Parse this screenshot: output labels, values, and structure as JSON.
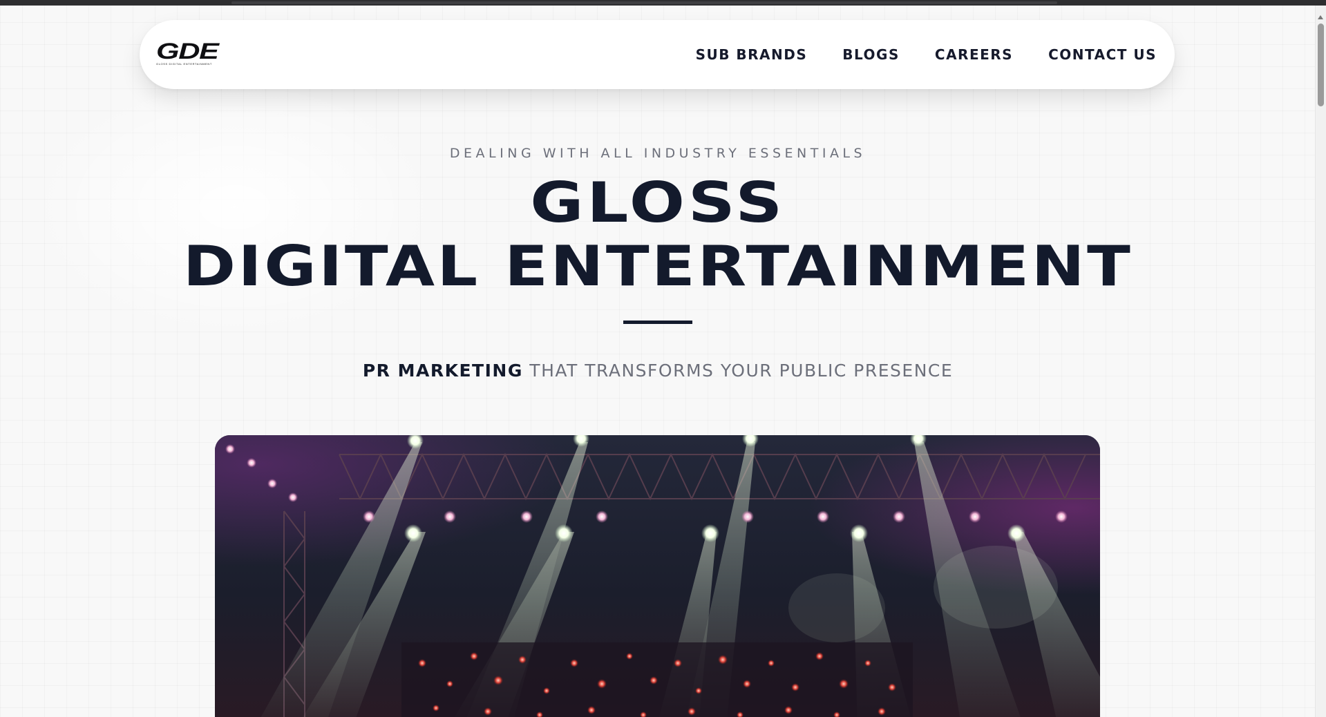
{
  "nav": {
    "logo_text": "GDE",
    "logo_sub": "GLOSS DIGITAL ENTERTAINMENT",
    "links": [
      {
        "label": "SUB BRANDS"
      },
      {
        "label": "BLOGS"
      },
      {
        "label": "CAREERS"
      },
      {
        "label": "CONTACT US"
      }
    ]
  },
  "hero": {
    "eyebrow": "DEALING WITH ALL INDUSTRY ESSENTIALS",
    "title_line1": "GLOSS",
    "title_line2": "DIGITAL ENTERTAINMENT",
    "tagline_bold": "PR MARKETING",
    "tagline_rest": " THAT TRANSFORMS YOUR PUBLIC PRESENCE"
  },
  "colors": {
    "ink": "#131a2c",
    "muted": "#6c6f7a",
    "page_bg": "#f8f8f8"
  }
}
